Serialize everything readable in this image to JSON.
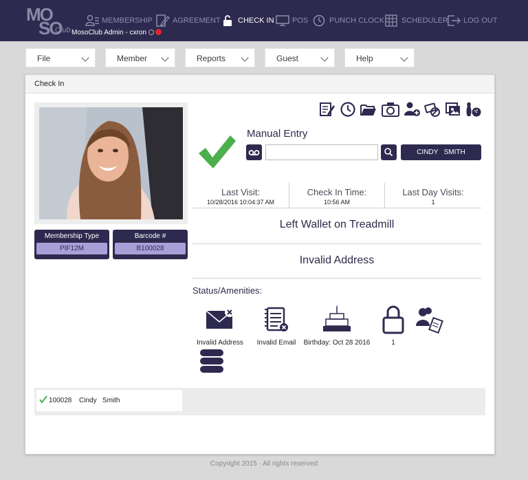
{
  "app": {
    "logo_top": "MO",
    "logo_bottom": "SO",
    "logo_suffix": "Club",
    "admin_label": "MosoClub Admin - cxron"
  },
  "nav": {
    "membership": "MEMBERSHIP",
    "agreement": "AGREEMENT",
    "checkin": "CHECK IN",
    "pos": "POS",
    "punchclock": "PUNCH CLOCK",
    "scheduler": "SCHEDULER",
    "logout": "LOG OUT"
  },
  "menus": [
    "File",
    "Member",
    "Reports",
    "Guest",
    "Help"
  ],
  "panel": {
    "title": "Check In"
  },
  "member": {
    "membership_type_label": "Membership Type",
    "membership_type": "PIF12M",
    "barcode_label": "Barcode #",
    "barcode": "B100028",
    "name": "CINDY   SMITH"
  },
  "manual_entry": {
    "title": "Manual Entry",
    "input_value": "",
    "input_placeholder": ""
  },
  "visits": {
    "last_visit_label": "Last Visit:",
    "last_visit": "10/28/2016 10:04:37 AM",
    "checkin_time_label": "Check In Time:",
    "checkin_time": "10:56 AM",
    "last_day_visits_label": "Last Day Visits:",
    "last_day_visits": "1"
  },
  "notes": {
    "note1": "Left Wallet on Treadmill",
    "note2": "Invalid Address"
  },
  "status": {
    "label": "Status/Amenities:",
    "items": [
      {
        "label": "Invalid Address",
        "icon": "envelope-x-icon"
      },
      {
        "label": "Invalid Email",
        "icon": "notepad-x-icon"
      },
      {
        "label": "Birthday: Oct 28 2016",
        "icon": "birthday-cake-icon"
      },
      {
        "label": "1",
        "icon": "lock-icon"
      },
      {
        "label": "",
        "icon": "member-clipboard-icon"
      },
      {
        "label": "",
        "icon": "towels-icon"
      }
    ]
  },
  "history": [
    {
      "barcode": "100028",
      "name": "Cindy   Smith"
    }
  ],
  "footer": "Copyright 2015 · All rights reserved",
  "colors": {
    "navy": "#2e2a4f",
    "lavender": "#a99fd8",
    "check_green": "#4cae4c",
    "status_red": "#e0252b"
  }
}
